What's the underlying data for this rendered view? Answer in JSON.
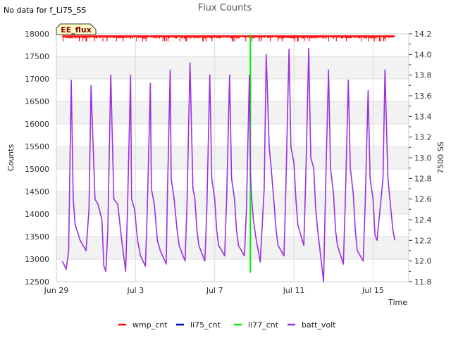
{
  "page": {
    "title": "Flux Counts",
    "no_data_note": "No data for f_Li75_SS",
    "badge": "EE_flux"
  },
  "chart_data": {
    "type": "line",
    "title": "Flux Counts",
    "xlabel": "Time",
    "ylabel": "Counts",
    "y2label": "7500 SS",
    "x_range_days": [
      0,
      17.8
    ],
    "x_ticks": [
      {
        "day": 0,
        "label": "Jun 29"
      },
      {
        "day": 4,
        "label": "Jul 3"
      },
      {
        "day": 8,
        "label": "Jul 7"
      },
      {
        "day": 12,
        "label": "Jul 11"
      },
      {
        "day": 16,
        "label": "Jul 15"
      }
    ],
    "ylim": [
      12500,
      18000
    ],
    "y_ticks": [
      12500,
      13000,
      13500,
      14000,
      14500,
      15000,
      15500,
      16000,
      16500,
      17000,
      17500,
      18000
    ],
    "y2lim": [
      11.8,
      14.2
    ],
    "y2_ticks": [
      11.8,
      12.0,
      12.2,
      12.4,
      12.6,
      12.8,
      13.0,
      13.2,
      13.4,
      13.6,
      13.8,
      14.0,
      14.2
    ],
    "grid": true,
    "legend_position": "bottom",
    "series": [
      {
        "name": "wmp_cnt",
        "color": "#ff0000",
        "axis": "left",
        "x": [
          0.3,
          17.1
        ],
        "y": [
          17930,
          17930
        ],
        "noise": 40
      },
      {
        "name": "li75_cnt",
        "color": "#0000cc",
        "axis": "left",
        "x": [],
        "y": []
      },
      {
        "name": "li77_cnt",
        "color": "#00ee00",
        "axis": "left",
        "x": [
          9.8,
          9.8
        ],
        "y": [
          12700,
          17980
        ]
      },
      {
        "name": "batt_volt",
        "color": "#9b30e0",
        "axis": "right",
        "x": [
          0.3,
          0.5,
          0.62,
          0.75,
          0.85,
          0.95,
          1.2,
          1.5,
          1.65,
          1.75,
          1.95,
          2.1,
          2.3,
          2.4,
          2.5,
          2.6,
          2.75,
          2.9,
          3.1,
          3.3,
          3.5,
          3.6,
          3.75,
          3.8,
          3.95,
          4.1,
          4.25,
          4.5,
          4.6,
          4.75,
          4.8,
          4.95,
          5.1,
          5.25,
          5.55,
          5.6,
          5.75,
          5.8,
          5.95,
          6.1,
          6.2,
          6.5,
          6.6,
          6.75,
          6.9,
          7.0,
          7.1,
          7.2,
          7.5,
          7.6,
          7.75,
          7.85,
          8.0,
          8.1,
          8.2,
          8.5,
          8.6,
          8.75,
          8.85,
          9.0,
          9.1,
          9.2,
          9.5,
          9.6,
          9.75,
          9.8,
          9.85,
          9.95,
          10.1,
          10.2,
          10.3,
          10.5,
          10.6,
          10.75,
          10.85,
          11.0,
          11.1,
          11.2,
          11.5,
          11.6,
          11.75,
          11.85,
          12.0,
          12.1,
          12.2,
          12.5,
          12.6,
          12.75,
          12.85,
          13.0,
          13.1,
          13.2,
          13.5,
          13.6,
          13.75,
          13.85,
          14.0,
          14.1,
          14.2,
          14.5,
          14.6,
          14.75,
          14.85,
          15.0,
          15.1,
          15.2,
          15.5,
          15.6,
          15.75,
          15.85,
          16.0,
          16.1,
          16.2,
          16.5,
          16.6,
          16.75,
          16.85,
          17.0,
          17.1
        ],
        "y": [
          12.0,
          11.92,
          12.1,
          13.75,
          12.6,
          12.35,
          12.2,
          12.1,
          12.5,
          13.7,
          12.6,
          12.55,
          12.4,
          11.95,
          11.9,
          12.3,
          13.8,
          12.6,
          12.55,
          12.2,
          11.9,
          12.55,
          13.8,
          12.6,
          12.5,
          12.2,
          12.05,
          11.95,
          12.55,
          13.72,
          12.7,
          12.55,
          12.2,
          12.1,
          11.97,
          12.55,
          13.85,
          12.8,
          12.6,
          12.3,
          12.15,
          12.0,
          12.55,
          13.92,
          12.7,
          12.6,
          12.3,
          12.15,
          12.0,
          12.5,
          13.8,
          12.8,
          12.6,
          12.3,
          12.15,
          12.05,
          12.6,
          13.8,
          12.8,
          12.6,
          12.3,
          12.15,
          12.05,
          12.5,
          13.8,
          12.9,
          12.65,
          12.4,
          12.2,
          12.1,
          11.99,
          12.7,
          14.0,
          13.1,
          12.9,
          12.55,
          12.3,
          12.15,
          12.05,
          12.75,
          14.05,
          13.1,
          12.95,
          12.6,
          12.35,
          12.15,
          12.8,
          14.06,
          13.0,
          12.9,
          12.5,
          12.3,
          11.8,
          12.7,
          13.85,
          12.9,
          12.65,
          12.3,
          12.15,
          11.97,
          12.6,
          13.75,
          12.9,
          12.65,
          12.3,
          12.1,
          12.0,
          12.55,
          13.65,
          12.8,
          12.6,
          12.25,
          12.2,
          12.8,
          13.85,
          12.8,
          12.6,
          12.3,
          12.2
        ]
      }
    ]
  }
}
